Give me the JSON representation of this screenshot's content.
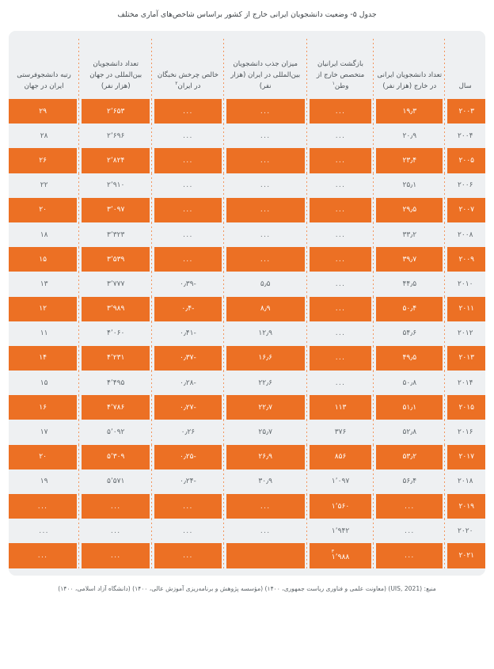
{
  "caption": "جدول ۵- وضعیت دانشجویان ایرانی خارج از کشور براساس شاخص‌های آماری مختلف",
  "colors": {
    "accent_orange": "#ec7024",
    "row_background": "#eef0f2",
    "divider_orange": "#f3955c",
    "text_gray": "#62696e",
    "header_text": "#4c5358"
  },
  "table": {
    "headers": [
      {
        "key": "year",
        "label": "سال"
      },
      {
        "key": "abroad",
        "label": "تعداد دانشجویان ایرانی در خارج (هزار نفر)"
      },
      {
        "key": "return",
        "label": "بازگشت ایرانیان متخصص خارج از وطن",
        "note": "۱"
      },
      {
        "key": "attract",
        "label": "میزان جذب دانشجویان بین‌المللی در ایران (هزار نفر)"
      },
      {
        "key": "brain",
        "label": "خالص چرخش نخبگان در ایران",
        "note": "۲"
      },
      {
        "key": "intl",
        "label": "تعداد دانشجویان بین‌المللی در جهان (هزار نفر)"
      },
      {
        "key": "rank",
        "label": "رتبه دانشجوفرستی ایران در جهان"
      }
    ],
    "placeholder": "...",
    "rows": [
      {
        "year": "۲۰۰۳",
        "abroad": "۱۹٫۳",
        "return": "...",
        "attract": "...",
        "brain": "...",
        "intl": "۲٬۶۵۳",
        "rank": "۲۹",
        "highlight": true
      },
      {
        "year": "۲۰۰۴",
        "abroad": "۲۰٫۹",
        "return": "...",
        "attract": "...",
        "brain": "...",
        "intl": "۲٬۶۹۶",
        "rank": "۲۸",
        "highlight": false
      },
      {
        "year": "۲۰۰۵",
        "abroad": "۲۳٫۴",
        "return": "...",
        "attract": "...",
        "brain": "...",
        "intl": "۲٬۸۲۴",
        "rank": "۲۶",
        "highlight": true
      },
      {
        "year": "۲۰۰۶",
        "abroad": "۲۵٫۱",
        "return": "...",
        "attract": "...",
        "brain": "...",
        "intl": "۲٬۹۱۰",
        "rank": "۲۲",
        "highlight": false
      },
      {
        "year": "۲۰۰۷",
        "abroad": "۲۹٫۵",
        "return": "...",
        "attract": "...",
        "brain": "...",
        "intl": "۳٬۰۹۷",
        "rank": "۲۰",
        "highlight": true
      },
      {
        "year": "۲۰۰۸",
        "abroad": "۳۳٫۲",
        "return": "...",
        "attract": "...",
        "brain": "...",
        "intl": "۳٬۳۲۳",
        "rank": "۱۸",
        "highlight": false
      },
      {
        "year": "۲۰۰۹",
        "abroad": "۳۹٫۷",
        "return": "...",
        "attract": "...",
        "brain": "...",
        "intl": "۳٬۵۳۹",
        "rank": "۱۵",
        "highlight": true
      },
      {
        "year": "۲۰۱۰",
        "abroad": "۴۴٫۵",
        "return": "...",
        "attract": "۵٫۵",
        "brain": "-۰٫۳۹",
        "intl": "۳٬۷۷۷",
        "rank": "۱۳",
        "highlight": false
      },
      {
        "year": "۲۰۱۱",
        "abroad": "۵۰٫۴",
        "return": "...",
        "attract": "۸٫۹",
        "brain": "-۰٫۴",
        "intl": "۳٬۹۸۹",
        "rank": "۱۲",
        "highlight": true
      },
      {
        "year": "۲۰۱۲",
        "abroad": "۵۴٫۶",
        "return": "...",
        "attract": "۱۲٫۹",
        "brain": "-۰٫۴۱",
        "intl": "۴٬۰۶۰",
        "rank": "۱۱",
        "highlight": false
      },
      {
        "year": "۲۰۱۳",
        "abroad": "۴۹٫۵",
        "return": "...",
        "attract": "۱۶٫۶",
        "brain": "-۰٫۳۷",
        "intl": "۴٬۲۳۱",
        "rank": "۱۴",
        "highlight": true
      },
      {
        "year": "۲۰۱۴",
        "abroad": "۵۰٫۸",
        "return": "...",
        "attract": "۲۲٫۶",
        "brain": "-۰٫۲۸",
        "intl": "۴٬۴۹۵",
        "rank": "۱۵",
        "highlight": false
      },
      {
        "year": "۲۰۱۵",
        "abroad": "۵۱٫۱",
        "return": "۱۱۳",
        "attract": "۲۲٫۷",
        "brain": "-۰٫۲۷",
        "intl": "۴٬۷۸۶",
        "rank": "۱۶",
        "highlight": true
      },
      {
        "year": "۲۰۱۶",
        "abroad": "۵۲٫۸",
        "return": "۳۷۶",
        "attract": "۲۵٫۷",
        "brain": "۰٫۲۶",
        "intl": "۵٬۰۹۲",
        "rank": "۱۷",
        "highlight": false
      },
      {
        "year": "۲۰۱۷",
        "abroad": "۵۳٫۲",
        "return": "۸۵۶",
        "attract": "۲۶٫۹",
        "brain": "-۰٫۲۵",
        "intl": "۵٬۳۰۹",
        "rank": "۲۰",
        "highlight": true
      },
      {
        "year": "۲۰۱۸",
        "abroad": "۵۶٫۴",
        "return": "۱٬۰۹۷",
        "attract": "۳۰٫۹",
        "brain": "-۰٫۲۴",
        "intl": "۵٬۵۷۱",
        "rank": "۱۹",
        "highlight": false
      },
      {
        "year": "۲۰۱۹",
        "abroad": "...",
        "return": "۱٬۵۶۰",
        "attract": "...",
        "brain": "...",
        "intl": "...",
        "rank": "...",
        "highlight": true
      },
      {
        "year": "۲۰۲۰",
        "abroad": "...",
        "return": "۱٬۹۴۲",
        "attract": "...",
        "brain": "...",
        "intl": "...",
        "rank": "...",
        "highlight": false
      },
      {
        "year": "۲۰۲۱",
        "abroad": "...",
        "return": "۱٬۹۸۸",
        "return_note": "۳",
        "attract": "",
        "brain": "...",
        "intl": "...",
        "rank": "...",
        "highlight": true
      }
    ]
  },
  "source": "منبع: (UIS, 2021) (معاونت علمی و فناوری ریاست جمهوری، ۱۴۰۰) (مؤسسه پژوهش و برنامه‌ریزی آموزش عالی، ۱۴۰۰) (دانشگاه آزاد اسلامی، ۱۴۰۰)"
}
